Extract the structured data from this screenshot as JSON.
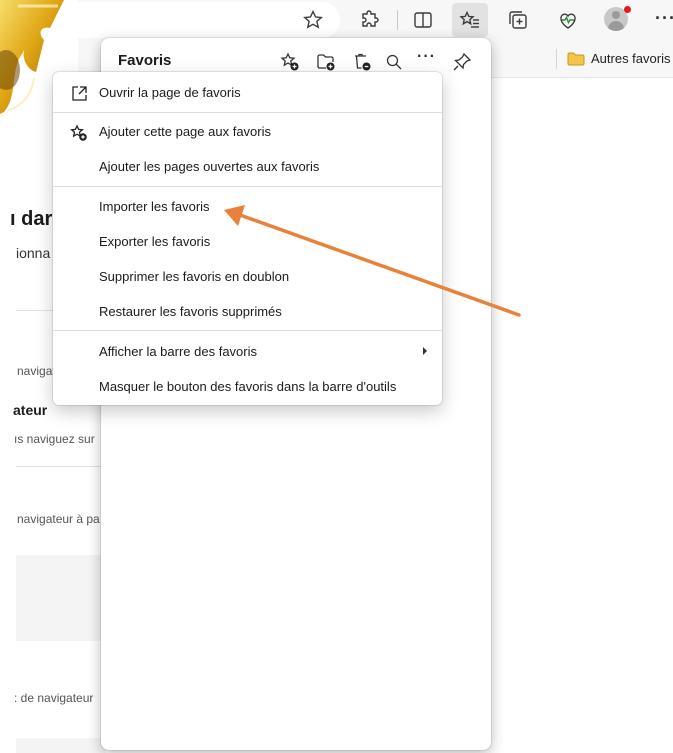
{
  "toolbar": {
    "icons": [
      "star-outline-icon",
      "extensions-icon",
      "split-screen-icon",
      "favorites-icon",
      "collections-icon",
      "browser-essentials-icon",
      "profile-avatar",
      "more-icon"
    ],
    "more_label": "···"
  },
  "favorites_bar": {
    "folder_label": "Autres favoris"
  },
  "background_page": {
    "heading_fragment": "ı dar",
    "subheading_fragment": "ionna",
    "text_navig": "navigat",
    "heading_2_fragment": "ateur",
    "text_naviguez": "ıs naviguez sur",
    "text_navigateur_pa": "navigateur à pa",
    "text_de_navigateur": ": de navigateur"
  },
  "panel": {
    "title": "Favoris",
    "header_icons": [
      "add-favorite-icon",
      "add-folder-icon",
      "delete-favorites-icon",
      "search-icon",
      "more-options-icon",
      "pin-icon"
    ],
    "more_label": "···"
  },
  "menu": {
    "items": [
      {
        "label": "Ouvrir la page de favoris",
        "icon": "open-external-icon"
      },
      {
        "label": "Ajouter cette page aux favoris",
        "icon": "add-favorite-icon"
      },
      {
        "label": "Ajouter les pages ouvertes aux favoris",
        "icon": ""
      },
      {
        "label": "Importer les favoris",
        "icon": ""
      },
      {
        "label": "Exporter les favoris",
        "icon": ""
      },
      {
        "label": "Supprimer les favoris en doublon",
        "icon": ""
      },
      {
        "label": "Restaurer les favoris supprimés",
        "icon": ""
      },
      {
        "label": "Afficher la barre des favoris",
        "icon": "",
        "has_submenu": true
      },
      {
        "label": "Masquer le bouton des favoris dans la barre d'outils",
        "icon": ""
      }
    ]
  },
  "annotation": {
    "arrow_color": "#e8823a",
    "points_to": "Importer les favoris"
  },
  "colors": {
    "accent_arrow": "#e8823a",
    "logo_gold": "#e0a514",
    "notification_dot": "#e11a1a"
  }
}
